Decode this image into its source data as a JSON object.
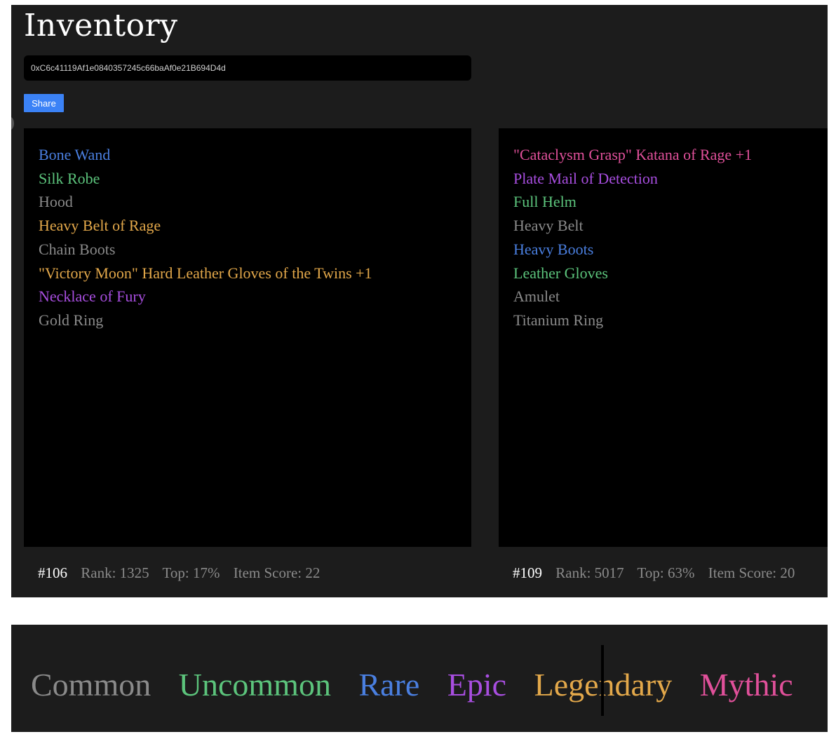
{
  "header": {
    "title": "Inventory",
    "address_value": "0xC6c41119Af1e0840357245c66baAf0e21B694D4d",
    "share_label": "Share"
  },
  "bags": [
    {
      "items": [
        {
          "name": "Bone Wand",
          "rarity": "Rare",
          "color": "#4a7fe0"
        },
        {
          "name": "Silk Robe",
          "rarity": "Uncommon",
          "color": "#5cc47c"
        },
        {
          "name": "Hood",
          "rarity": "Common",
          "color": "#8a8a8a"
        },
        {
          "name": "Heavy Belt of Rage",
          "rarity": "Legendary",
          "color": "#e3a84a"
        },
        {
          "name": "Chain Boots",
          "rarity": "Common",
          "color": "#8a8a8a"
        },
        {
          "name": "\"Victory Moon\" Hard Leather Gloves of the Twins +1",
          "rarity": "Legendary",
          "color": "#e3a84a"
        },
        {
          "name": "Necklace of Fury",
          "rarity": "Epic",
          "color": "#a84ee0"
        },
        {
          "name": "Gold Ring",
          "rarity": "Common",
          "color": "#8a8a8a"
        }
      ],
      "stats": {
        "id": "#106",
        "rank": "Rank: 1325",
        "top": "Top: 17%",
        "score": "Item Score: 22"
      }
    },
    {
      "items": [
        {
          "name": "\"Cataclysm Grasp\" Katana of Rage +1",
          "rarity": "Mythic",
          "color": "#e0509a"
        },
        {
          "name": "Plate Mail of Detection",
          "rarity": "Epic",
          "color": "#a84ee0"
        },
        {
          "name": "Full Helm",
          "rarity": "Uncommon",
          "color": "#5cc47c"
        },
        {
          "name": "Heavy Belt",
          "rarity": "Common",
          "color": "#8a8a8a"
        },
        {
          "name": "Heavy Boots",
          "rarity": "Rare",
          "color": "#4a7fe0"
        },
        {
          "name": "Leather Gloves",
          "rarity": "Uncommon",
          "color": "#5cc47c"
        },
        {
          "name": "Amulet",
          "rarity": "Common",
          "color": "#8a8a8a"
        },
        {
          "name": "Titanium Ring",
          "rarity": "Common",
          "color": "#8a8a8a"
        }
      ],
      "stats": {
        "id": "#109",
        "rank": "Rank: 5017",
        "top": "Top: 63%",
        "score": "Item Score: 20"
      }
    }
  ],
  "legend": [
    {
      "label": "Common",
      "color": "#8a8a8a"
    },
    {
      "label": "Uncommon",
      "color": "#5cc47c"
    },
    {
      "label": "Rare",
      "color": "#4a7fe0"
    },
    {
      "label": "Epic",
      "color": "#a84ee0"
    },
    {
      "label": "Legendary",
      "color": "#e3a84a"
    },
    {
      "label": "Mythic",
      "color": "#e0509a"
    }
  ]
}
